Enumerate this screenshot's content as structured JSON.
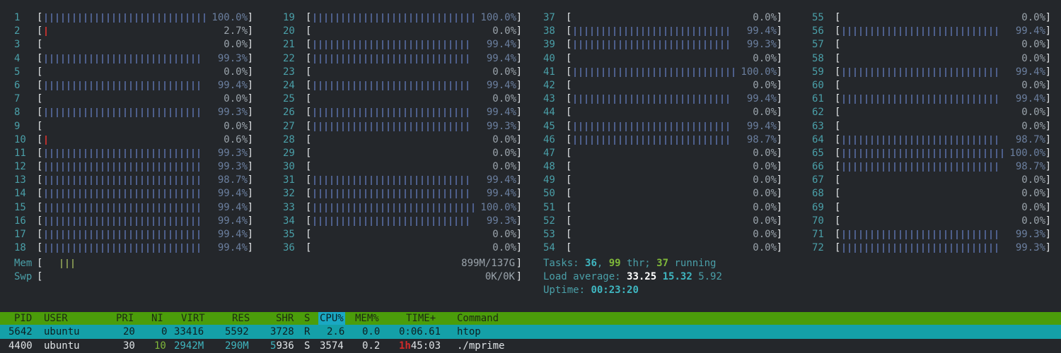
{
  "cpus": {
    "columns": [
      [
        {
          "n": "1",
          "pct": "100.0%",
          "fill": 1.0,
          "low": false
        },
        {
          "n": "2",
          "pct": "2.7%",
          "fill": 0.027,
          "low": true
        },
        {
          "n": "3",
          "pct": "0.0%",
          "fill": 0,
          "low": false
        },
        {
          "n": "4",
          "pct": "99.3%",
          "fill": 0.993,
          "low": false
        },
        {
          "n": "5",
          "pct": "0.0%",
          "fill": 0,
          "low": false
        },
        {
          "n": "6",
          "pct": "99.4%",
          "fill": 0.994,
          "low": false
        },
        {
          "n": "7",
          "pct": "0.0%",
          "fill": 0,
          "low": false
        },
        {
          "n": "8",
          "pct": "99.3%",
          "fill": 0.993,
          "low": false
        },
        {
          "n": "9",
          "pct": "0.0%",
          "fill": 0,
          "low": false
        },
        {
          "n": "10",
          "pct": "0.6%",
          "fill": 0.03,
          "low": true
        },
        {
          "n": "11",
          "pct": "99.3%",
          "fill": 0.993,
          "low": false
        },
        {
          "n": "12",
          "pct": "99.3%",
          "fill": 0.993,
          "low": false
        },
        {
          "n": "13",
          "pct": "98.7%",
          "fill": 0.987,
          "low": false
        },
        {
          "n": "14",
          "pct": "99.4%",
          "fill": 0.994,
          "low": false
        },
        {
          "n": "15",
          "pct": "99.4%",
          "fill": 0.994,
          "low": false
        },
        {
          "n": "16",
          "pct": "99.4%",
          "fill": 0.994,
          "low": false
        },
        {
          "n": "17",
          "pct": "99.4%",
          "fill": 0.994,
          "low": false
        },
        {
          "n": "18",
          "pct": "99.4%",
          "fill": 0.994,
          "low": false
        }
      ],
      [
        {
          "n": "19",
          "pct": "100.0%",
          "fill": 1.0,
          "low": false
        },
        {
          "n": "20",
          "pct": "0.0%",
          "fill": 0,
          "low": false
        },
        {
          "n": "21",
          "pct": "99.4%",
          "fill": 0.994,
          "low": false
        },
        {
          "n": "22",
          "pct": "99.4%",
          "fill": 0.994,
          "low": false
        },
        {
          "n": "23",
          "pct": "0.0%",
          "fill": 0,
          "low": false
        },
        {
          "n": "24",
          "pct": "99.4%",
          "fill": 0.994,
          "low": false
        },
        {
          "n": "25",
          "pct": "0.0%",
          "fill": 0,
          "low": false
        },
        {
          "n": "26",
          "pct": "99.4%",
          "fill": 0.994,
          "low": false
        },
        {
          "n": "27",
          "pct": "99.3%",
          "fill": 0.993,
          "low": false
        },
        {
          "n": "28",
          "pct": "0.0%",
          "fill": 0,
          "low": false
        },
        {
          "n": "29",
          "pct": "0.0%",
          "fill": 0,
          "low": false
        },
        {
          "n": "30",
          "pct": "0.0%",
          "fill": 0,
          "low": false
        },
        {
          "n": "31",
          "pct": "99.4%",
          "fill": 0.994,
          "low": false
        },
        {
          "n": "32",
          "pct": "99.4%",
          "fill": 0.994,
          "low": false
        },
        {
          "n": "33",
          "pct": "100.0%",
          "fill": 1.0,
          "low": false
        },
        {
          "n": "34",
          "pct": "99.3%",
          "fill": 0.993,
          "low": false
        },
        {
          "n": "35",
          "pct": "0.0%",
          "fill": 0,
          "low": false
        },
        {
          "n": "36",
          "pct": "0.0%",
          "fill": 0,
          "low": false
        }
      ],
      [
        {
          "n": "37",
          "pct": "0.0%",
          "fill": 0,
          "low": false
        },
        {
          "n": "38",
          "pct": "99.4%",
          "fill": 0.994,
          "low": false
        },
        {
          "n": "39",
          "pct": "99.3%",
          "fill": 0.993,
          "low": false
        },
        {
          "n": "40",
          "pct": "0.0%",
          "fill": 0,
          "low": false
        },
        {
          "n": "41",
          "pct": "100.0%",
          "fill": 1.0,
          "low": false
        },
        {
          "n": "42",
          "pct": "0.0%",
          "fill": 0,
          "low": false
        },
        {
          "n": "43",
          "pct": "99.4%",
          "fill": 0.994,
          "low": false
        },
        {
          "n": "44",
          "pct": "0.0%",
          "fill": 0,
          "low": false
        },
        {
          "n": "45",
          "pct": "99.4%",
          "fill": 0.994,
          "low": false
        },
        {
          "n": "46",
          "pct": "98.7%",
          "fill": 0.987,
          "low": false
        },
        {
          "n": "47",
          "pct": "0.0%",
          "fill": 0,
          "low": false
        },
        {
          "n": "48",
          "pct": "0.0%",
          "fill": 0,
          "low": false
        },
        {
          "n": "49",
          "pct": "0.0%",
          "fill": 0,
          "low": false
        },
        {
          "n": "50",
          "pct": "0.0%",
          "fill": 0,
          "low": false
        },
        {
          "n": "51",
          "pct": "0.0%",
          "fill": 0,
          "low": false
        },
        {
          "n": "52",
          "pct": "0.0%",
          "fill": 0,
          "low": false
        },
        {
          "n": "53",
          "pct": "0.0%",
          "fill": 0,
          "low": false
        },
        {
          "n": "54",
          "pct": "0.0%",
          "fill": 0,
          "low": false
        }
      ],
      [
        {
          "n": "55",
          "pct": "0.0%",
          "fill": 0,
          "low": false
        },
        {
          "n": "56",
          "pct": "99.4%",
          "fill": 0.994,
          "low": false
        },
        {
          "n": "57",
          "pct": "0.0%",
          "fill": 0,
          "low": false
        },
        {
          "n": "58",
          "pct": "0.0%",
          "fill": 0,
          "low": false
        },
        {
          "n": "59",
          "pct": "99.4%",
          "fill": 0.994,
          "low": false
        },
        {
          "n": "60",
          "pct": "0.0%",
          "fill": 0,
          "low": false
        },
        {
          "n": "61",
          "pct": "99.4%",
          "fill": 0.994,
          "low": false
        },
        {
          "n": "62",
          "pct": "0.0%",
          "fill": 0,
          "low": false
        },
        {
          "n": "63",
          "pct": "0.0%",
          "fill": 0,
          "low": false
        },
        {
          "n": "64",
          "pct": "98.7%",
          "fill": 0.987,
          "low": false
        },
        {
          "n": "65",
          "pct": "100.0%",
          "fill": 1.0,
          "low": false
        },
        {
          "n": "66",
          "pct": "98.7%",
          "fill": 0.987,
          "low": false
        },
        {
          "n": "67",
          "pct": "0.0%",
          "fill": 0,
          "low": false
        },
        {
          "n": "68",
          "pct": "0.0%",
          "fill": 0,
          "low": false
        },
        {
          "n": "69",
          "pct": "0.0%",
          "fill": 0,
          "low": false
        },
        {
          "n": "70",
          "pct": "0.0%",
          "fill": 0,
          "low": false
        },
        {
          "n": "71",
          "pct": "99.3%",
          "fill": 0.993,
          "low": false
        },
        {
          "n": "72",
          "pct": "99.3%",
          "fill": 0.993,
          "low": false
        }
      ]
    ]
  },
  "meters": {
    "mem_label": "Mem",
    "mem_value": "899M/137G",
    "swp_label": "Swp",
    "swp_value": "0K/0K"
  },
  "info": {
    "tasks_label": "Tasks: ",
    "tasks_count": "36",
    "tasks_sep": ", ",
    "threads": "99",
    "thr_label": " thr; ",
    "running": "37",
    "running_label": " running",
    "load_label": "Load average: ",
    "load1": "33.25",
    "load5": "15.32",
    "load15": "5.92",
    "uptime_label": "Uptime: ",
    "uptime": "00:23:20"
  },
  "process_table": {
    "headers": {
      "pid": "PID",
      "user": "USER",
      "pri": "PRI",
      "ni": "NI",
      "virt": "VIRT",
      "res": "RES",
      "shr": "SHR",
      "s": "S",
      "cpu": "CPU%",
      "mem": "MEM%",
      "time": "TIME+",
      "command": "Command"
    },
    "rows": [
      {
        "pid": "5642",
        "user": "ubuntu",
        "pri": "20",
        "ni": "0",
        "virt": "33416",
        "res": "5592",
        "shr": "3728",
        "s": "R",
        "cpu": "2.6",
        "mem": "0.0",
        "time": "0:06.61",
        "command": "htop"
      },
      {
        "pid": "4400",
        "user": "ubuntu",
        "pri": "30",
        "ni": "10",
        "virt": "2942M",
        "res": "290M",
        "shr_a": "5",
        "shr_b": "936",
        "s": "S",
        "cpu": "3574",
        "mem": "0.2",
        "time_h": "1h",
        "time_rest": "45:03",
        "command": "./mprime"
      }
    ]
  },
  "colors": {
    "background": "#24272b",
    "header_bg": "#4b9d0a",
    "selected_row_bg": "#14a0a8",
    "bar": "#4d5e8a",
    "bar_low": "#b8312f"
  }
}
